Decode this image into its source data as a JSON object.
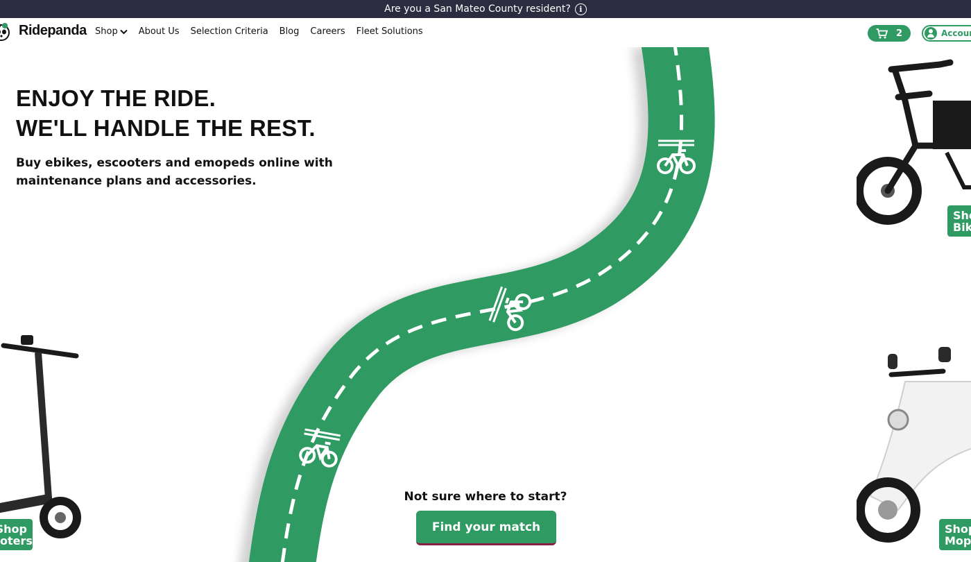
{
  "announcement": {
    "text": "Are you a San Mateo County resident?"
  },
  "brand": {
    "name": "Ridepanda"
  },
  "nav": {
    "shop": "Shop",
    "about": "About Us",
    "criteria": "Selection Criteria",
    "blog": "Blog",
    "careers": "Careers",
    "fleet": "Fleet Solutions"
  },
  "cart": {
    "count": "2"
  },
  "account": {
    "label": "Account"
  },
  "hero": {
    "line1": "ENJOY THE RIDE.",
    "line2": "WE'LL HANDLE THE REST.",
    "subtitle": "Buy ebikes, escooters and emopeds online with maintenance plans and accessories."
  },
  "tiles": {
    "bikes": {
      "line1": "Shop",
      "line2": "Bikes"
    },
    "scooters": {
      "line1": "Shop",
      "line2": "Scooters"
    },
    "mopeds": {
      "line1": "Shop",
      "line2": "Mopeds"
    }
  },
  "cta": {
    "question": "Not sure where to start?",
    "button": "Find your match"
  },
  "colors": {
    "brand_green": "#2f9a62",
    "topbar": "#2b2c3f",
    "cta_underline": "#8a1f46"
  }
}
